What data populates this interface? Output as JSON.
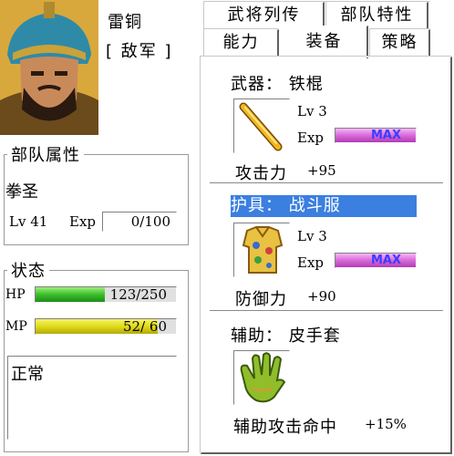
{
  "general": {
    "name": "雷铜",
    "faction": "[ 敌军 ]"
  },
  "tabs": [
    "武将列传",
    "部队特性",
    "能力",
    "装备",
    "策略"
  ],
  "active_tab": "装备",
  "troop": {
    "title": "部队属性",
    "class": "拳圣",
    "level_label": "Lv 41",
    "exp_label": "Exp",
    "exp_value": "0/100"
  },
  "status": {
    "title": "状态",
    "hp_label": "HP",
    "hp_text": "123/250",
    "hp_fraction": 0.492,
    "mp_label": "MP",
    "mp_text": "52/ 60",
    "mp_fraction": 0.867,
    "condition": "正常"
  },
  "equipment": {
    "weapon": {
      "header": "武器：  铁棍",
      "level": "Lv  3",
      "exp_label": "Exp",
      "exp_bar": "MAX",
      "stat_label": "攻击力",
      "stat_value": "+95",
      "icon": "iron-staff-icon"
    },
    "armor": {
      "header": "护具：  战斗服",
      "level": "Lv  3",
      "exp_label": "Exp",
      "exp_bar": "MAX",
      "stat_label": "防御力",
      "stat_value": "+90",
      "icon": "battle-suit-icon"
    },
    "auxiliary": {
      "header": "辅助：  皮手套",
      "stat_label": "辅助攻击命中",
      "stat_value": "+15%",
      "icon": "leather-glove-icon"
    }
  },
  "colors": {
    "selection": "#3b7fe0",
    "hp": "#3bbd2a",
    "mp": "#e0da18",
    "max_bar": "#d76ad9",
    "max_text": "#3c3cff"
  }
}
